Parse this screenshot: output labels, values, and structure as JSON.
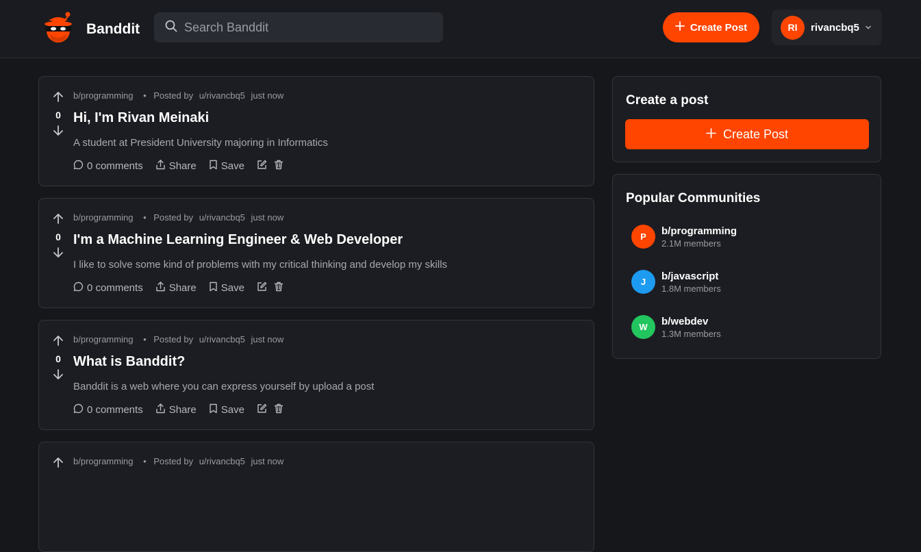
{
  "app": {
    "name": "Banddit",
    "search_placeholder": "Search Banddit",
    "create_post_label": "Create Post",
    "user": {
      "initials": "RI",
      "username": "rivancbq5"
    }
  },
  "posts": [
    {
      "community": "b/programming",
      "posted_by_label": "Posted by",
      "author": "u/rivancbq5",
      "time": "just now",
      "votes": "0",
      "title": "Hi, I'm Rivan Meinaki",
      "body": "A student at President University majoring in Informatics",
      "comments": "0 comments",
      "share": "Share",
      "save": "Save"
    },
    {
      "community": "b/programming",
      "posted_by_label": "Posted by",
      "author": "u/rivancbq5",
      "time": "just now",
      "votes": "0",
      "title": "I'm a Machine Learning Engineer & Web Developer",
      "body": "I like to solve some kind of problems with my critical thinking and develop my skills",
      "comments": "0 comments",
      "share": "Share",
      "save": "Save"
    },
    {
      "community": "b/programming",
      "posted_by_label": "Posted by",
      "author": "u/rivancbq5",
      "time": "just now",
      "votes": "0",
      "title": "What is Banddit?",
      "body": "Banddit is a web where you can express yourself by upload a post",
      "comments": "0 comments",
      "share": "Share",
      "save": "Save"
    },
    {
      "community": "b/programming",
      "posted_by_label": "Posted by",
      "author": "u/rivancbq5",
      "time": "just now"
    }
  ],
  "sidebar": {
    "create_card": {
      "title": "Create a post",
      "button_label": "Create Post"
    },
    "popular": {
      "title": "Popular Communities",
      "communities": [
        {
          "initial": "P",
          "name": "b/programming",
          "members": "2.1M members",
          "color": "#ff4500"
        },
        {
          "initial": "J",
          "name": "b/javascript",
          "members": "1.8M members",
          "color": "#1d9bf0"
        },
        {
          "initial": "W",
          "name": "b/webdev",
          "members": "1.3M members",
          "color": "#22c55e"
        }
      ]
    }
  },
  "colors": {
    "accent": "#ff4500",
    "background": "#16171b",
    "card": "#1c1d22"
  }
}
